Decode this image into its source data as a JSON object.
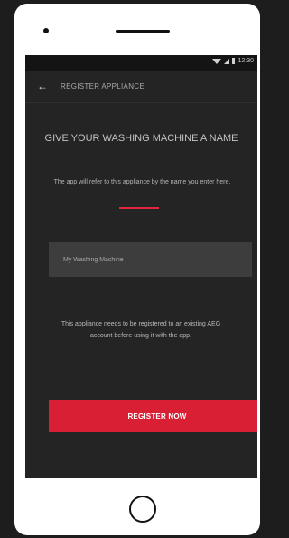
{
  "status_bar": {
    "time": "12:30",
    "icons": [
      "wifi-icon",
      "signal-icon",
      "battery-icon"
    ]
  },
  "app_bar": {
    "back_icon": "arrow-left",
    "title": "REGISTER APPLIANCE"
  },
  "main": {
    "heading": "GIVE YOUR WASHING MACHINE A NAME",
    "helper_text": "The app will refer to this appliance by the name you enter here.",
    "name_input": {
      "value": "My Washing Machine",
      "placeholder": ""
    },
    "notice": "This appliance needs to be registered to an existing AEG account before using it with the app.",
    "register_button": "REGISTER NOW"
  },
  "colors": {
    "accent": "#d91f33",
    "screen_background": "#242424",
    "input_background": "#3d3d3d"
  }
}
